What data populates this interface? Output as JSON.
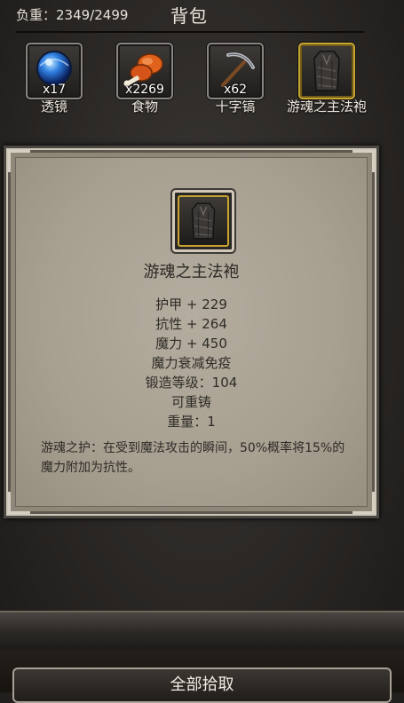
{
  "header": {
    "weight_text": "负重：2349/2499",
    "title": "背包"
  },
  "slots": [
    {
      "label": "透镜",
      "count": "x17",
      "icon": "lens-orb-icon"
    },
    {
      "label": "食物",
      "count": "x2269",
      "icon": "roasted-meat-icon"
    },
    {
      "label": "十字镐",
      "count": "x62",
      "icon": "pickaxe-icon"
    },
    {
      "label": "游魂之主法袍",
      "count": "",
      "icon": "robe-icon",
      "selected": true
    }
  ],
  "detail": {
    "name": "游魂之主法袍",
    "icon": "robe-icon",
    "stats": [
      "护甲 + 229",
      "抗性 + 264",
      "魔力 + 450",
      "魔力衰减免疫",
      "锻造等级：104",
      "可重铸",
      "重量：1"
    ],
    "description": "游魂之护：在受到魔法攻击的瞬间，50%概率将15%的魔力附加为抗性。"
  },
  "footer": {
    "pickup_all_label": "全部拾取"
  },
  "colors": {
    "panel": "#a79f90",
    "gold_frame": "#c8a632",
    "orb_blue": "#2f7fe0",
    "meat_orange": "#e0621c"
  }
}
